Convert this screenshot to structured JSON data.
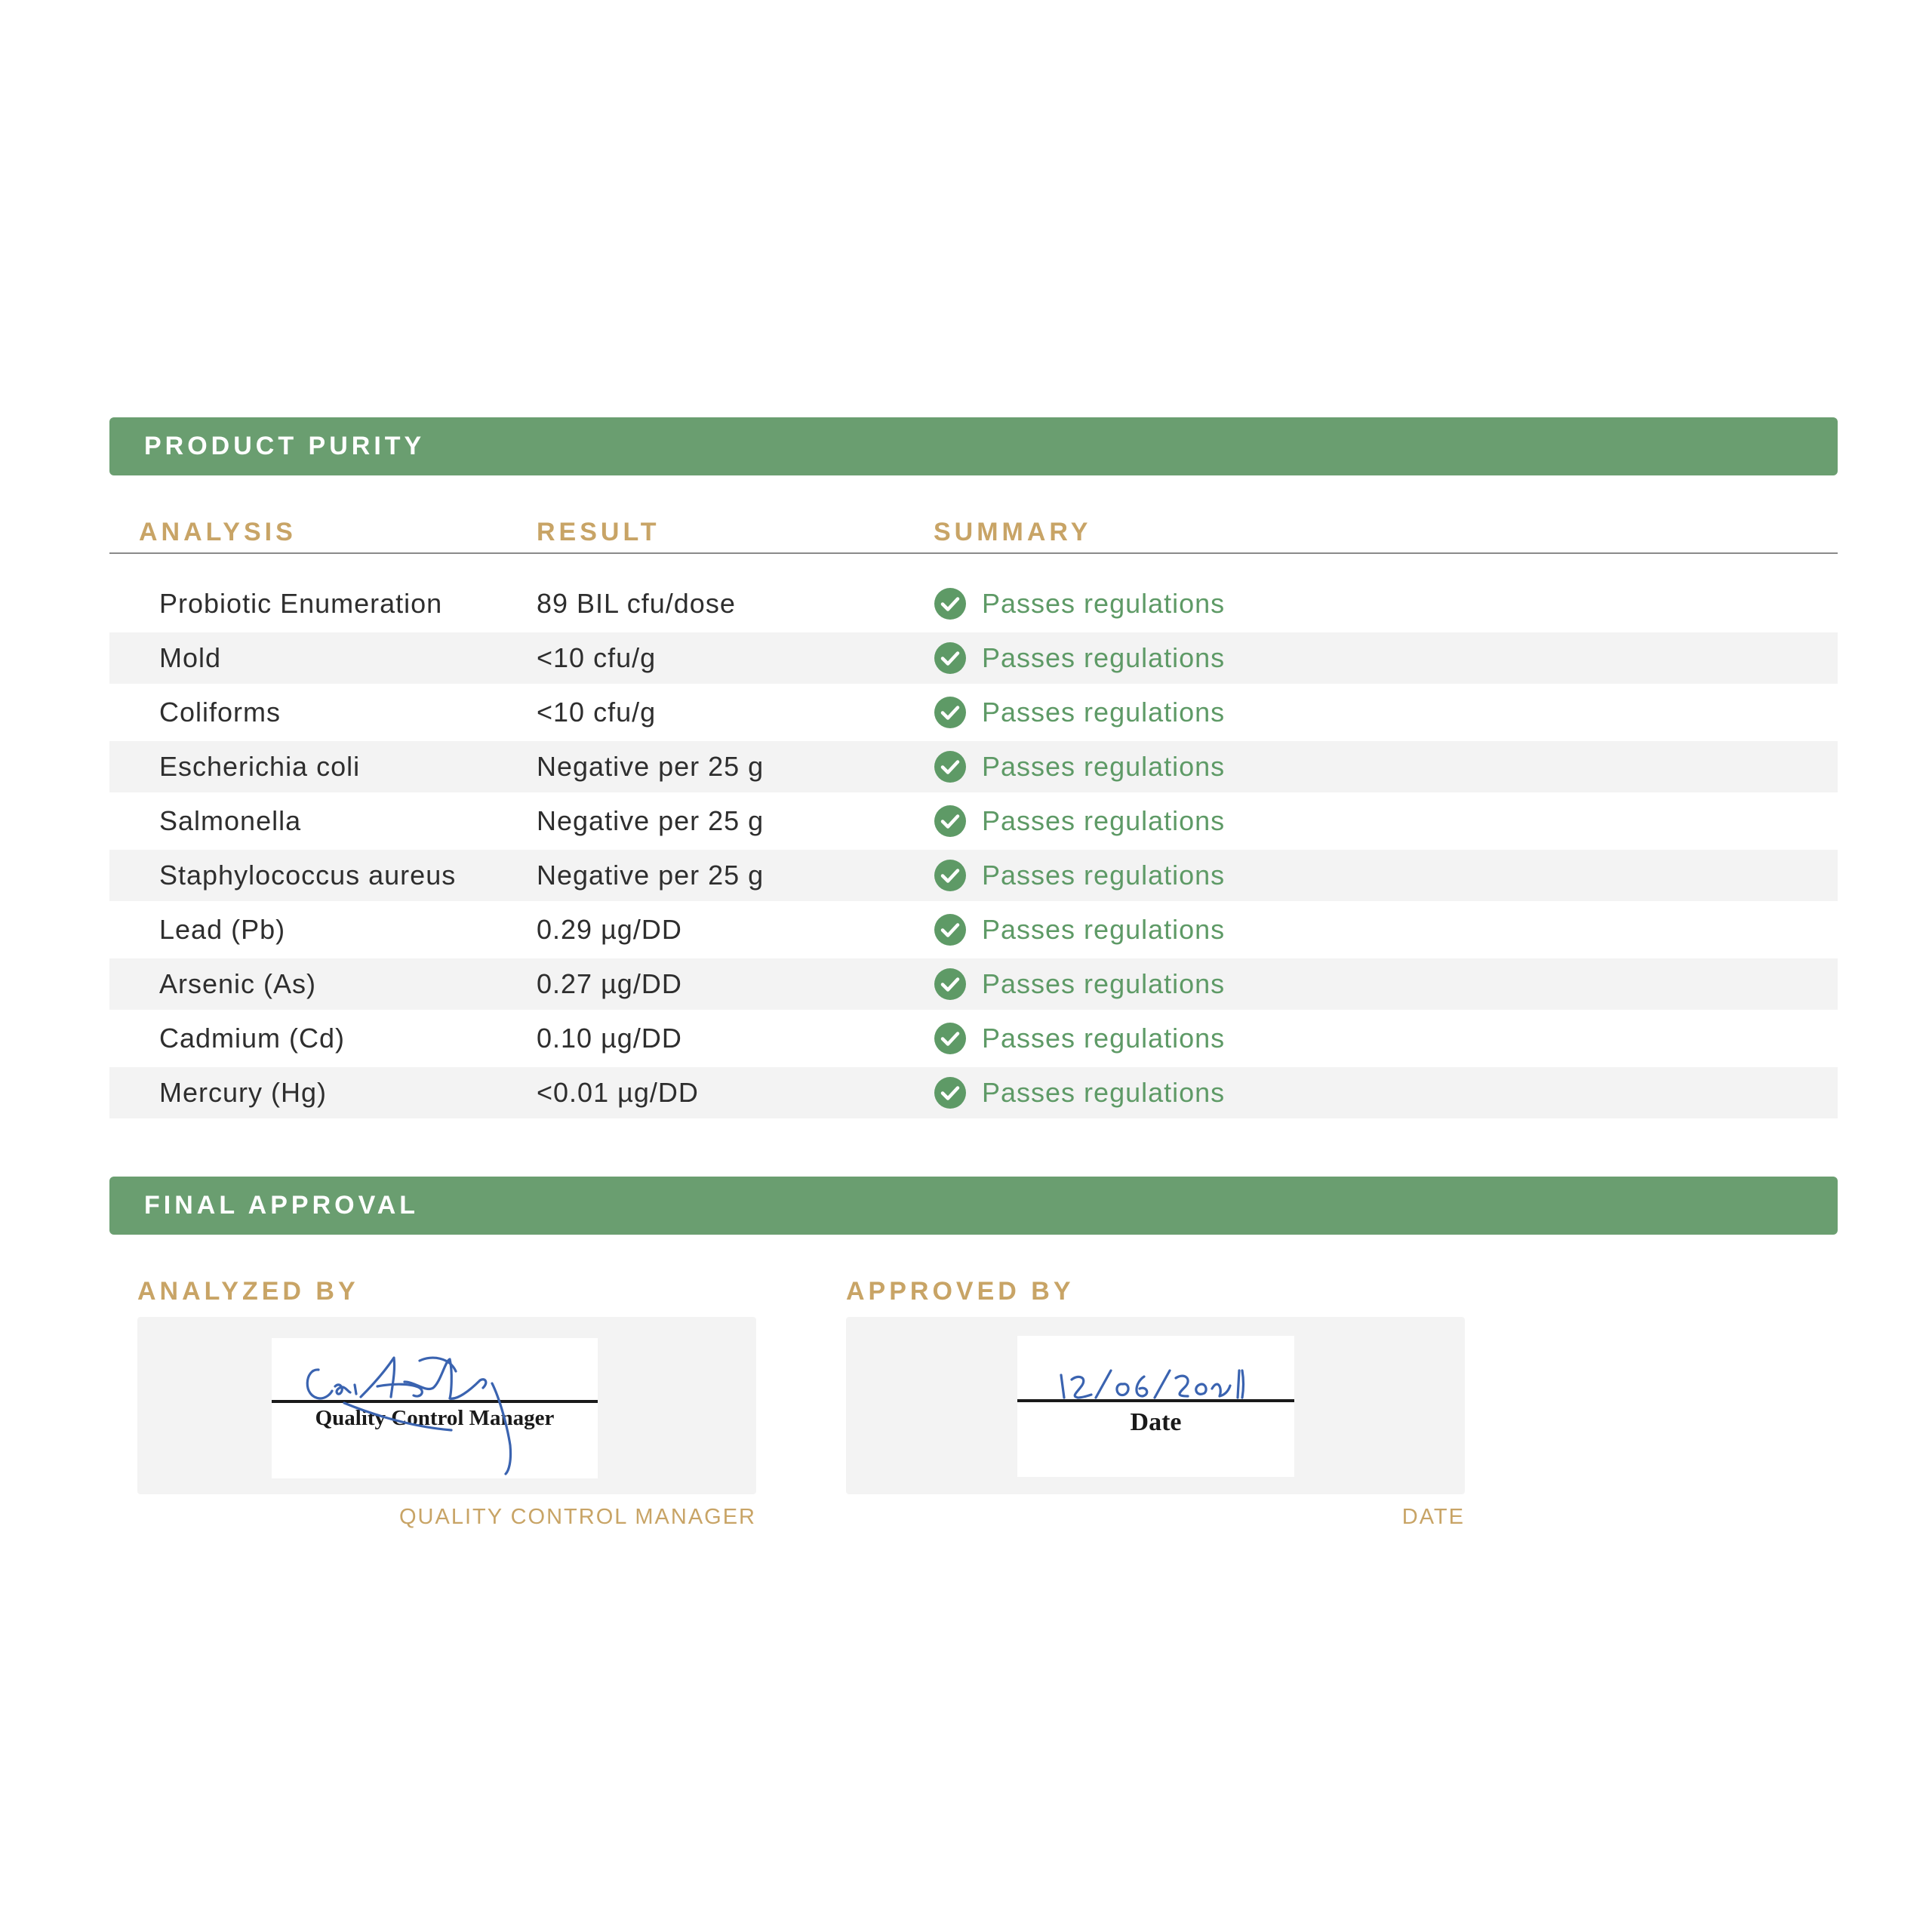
{
  "colors": {
    "accent_green": "#6a9e70",
    "label_gold": "#c8a466",
    "check_green": "#5e9a66",
    "pass_text": "#5e9a66"
  },
  "purity": {
    "title": "PRODUCT PURITY",
    "columns": {
      "analysis": "ANALYSIS",
      "result": "RESULT",
      "summary": "SUMMARY"
    },
    "rows": [
      {
        "analysis": "Probiotic Enumeration",
        "result": "89 BIL cfu/dose",
        "summary": "Passes regulations",
        "icon": "check-circle-icon"
      },
      {
        "analysis": "Mold",
        "result": "<10 cfu/g",
        "summary": "Passes regulations",
        "icon": "check-circle-icon"
      },
      {
        "analysis": "Coliforms",
        "result": "<10 cfu/g",
        "summary": "Passes regulations",
        "icon": "check-circle-icon"
      },
      {
        "analysis": "Escherichia coli",
        "result": "Negative per 25 g",
        "summary": "Passes regulations",
        "icon": "check-circle-icon"
      },
      {
        "analysis": "Salmonella",
        "result": "Negative per 25 g",
        "summary": "Passes regulations",
        "icon": "check-circle-icon"
      },
      {
        "analysis": "Staphylococcus aureus",
        "result": "Negative per 25 g",
        "summary": "Passes regulations",
        "icon": "check-circle-icon"
      },
      {
        "analysis": "Lead (Pb)",
        "result": "0.29 µg/DD",
        "summary": "Passes regulations",
        "icon": "check-circle-icon"
      },
      {
        "analysis": "Arsenic (As)",
        "result": "0.27 µg/DD",
        "summary": "Passes regulations",
        "icon": "check-circle-icon"
      },
      {
        "analysis": "Cadmium (Cd)",
        "result": "0.10 µg/DD",
        "summary": "Passes regulations",
        "icon": "check-circle-icon"
      },
      {
        "analysis": "Mercury (Hg)",
        "result": "<0.01 µg/DD",
        "summary": "Passes regulations",
        "icon": "check-circle-icon"
      }
    ]
  },
  "approval": {
    "title": "FINAL APPROVAL",
    "analyzed_by": {
      "label": "ANALYZED BY",
      "signature_print": "Quality Control Manager",
      "caption": "QUALITY CONTROL MANAGER"
    },
    "approved_by": {
      "label": "APPROVED BY",
      "handwritten_date": "12/06/2021",
      "signature_print": "Date",
      "caption": "DATE"
    }
  }
}
